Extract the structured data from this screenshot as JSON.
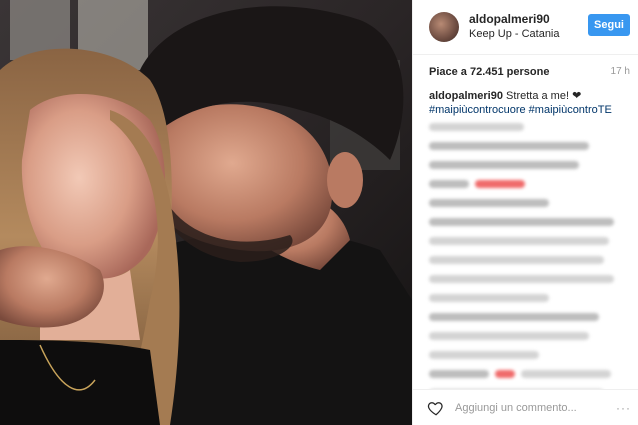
{
  "header": {
    "username": "aldopalmeri90",
    "location": "Keep Up - Catania",
    "follow_label": "Segui"
  },
  "meta": {
    "likes": "Piace a 72.451 persone",
    "time": "17 h"
  },
  "caption": {
    "username": "aldopalmeri90",
    "text": "Stretta a me! ❤",
    "hashtags": "#maipiùcontrocuore #maipiùcontroTE"
  },
  "comment_box": {
    "placeholder": "Aggiungi un commento..."
  },
  "icons": {
    "like": "heart-outline-icon",
    "more": "more-options-icon"
  },
  "colors": {
    "accent": "#3897f0",
    "hashtag": "#003569"
  }
}
